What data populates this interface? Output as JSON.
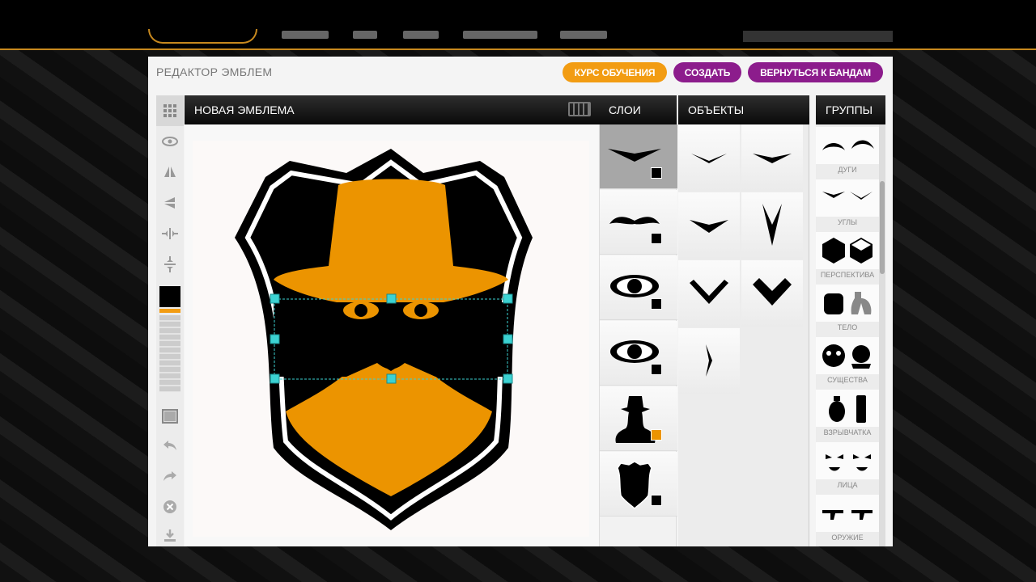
{
  "header": {
    "editor_title": "РЕДАКТОР ЭМБЛЕМ",
    "buttons": {
      "tutorial": "КУРС ОБУЧЕНИЯ",
      "create": "СОЗДАТЬ",
      "back_to_gangs": "ВЕРНУТЬСЯ К БАНДАМ"
    }
  },
  "canvas": {
    "title": "НОВАЯ ЭМБЛЕМА"
  },
  "panels": {
    "layers_title": "СЛОИ",
    "objects_title": "ОБЪЕКТЫ",
    "groups_title": "ГРУППЫ"
  },
  "layers": [
    {
      "name": "angle-shape",
      "color": "#000000",
      "selected": true
    },
    {
      "name": "mustache",
      "color": "#000000",
      "selected": false
    },
    {
      "name": "eye",
      "color": "#000000",
      "selected": false
    },
    {
      "name": "eye",
      "color": "#000000",
      "selected": false
    },
    {
      "name": "hat-figure",
      "color": "#f29c12",
      "selected": false
    },
    {
      "name": "shield",
      "color": "#000000",
      "selected": false
    }
  ],
  "groups": [
    {
      "label": "ДУГИ"
    },
    {
      "label": "УГЛЫ"
    },
    {
      "label": "ПЕРСПЕКТИВА"
    },
    {
      "label": "ТЕЛО"
    },
    {
      "label": "СУЩЕСТВА"
    },
    {
      "label": "ВЗРЫВЧАТКА"
    },
    {
      "label": "ЛИЦА"
    },
    {
      "label": "ОРУЖИЕ"
    }
  ],
  "colors": {
    "accent": "#f29c12",
    "purple": "#8c1c8c",
    "emblem_orange": "#ec9400",
    "handle": "#3cd2d2"
  }
}
